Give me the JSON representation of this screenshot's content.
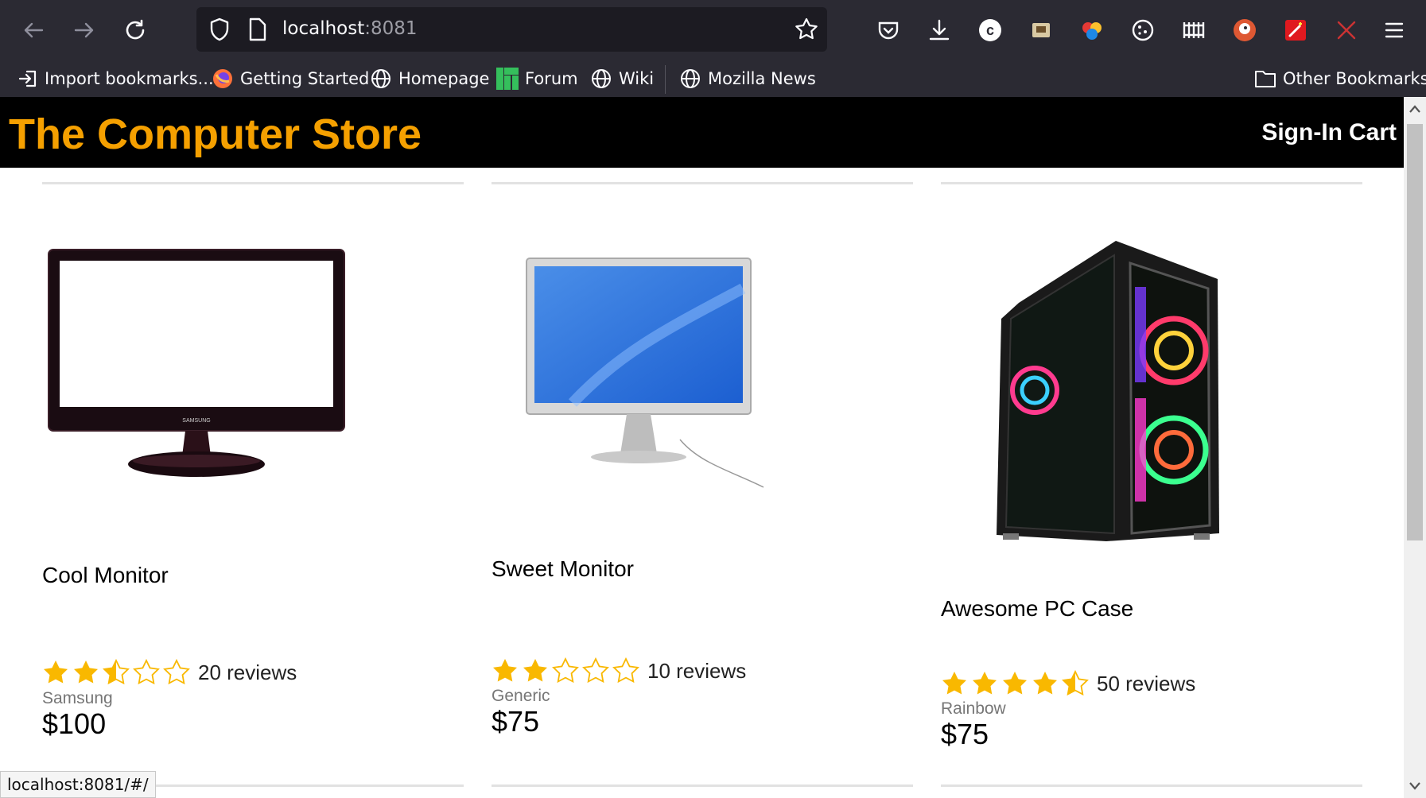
{
  "browser": {
    "url_host": "localhost",
    "url_port": ":8081",
    "bookmarks": [
      {
        "label": "Import bookmarks...",
        "icon": "import-icon"
      },
      {
        "label": "Getting Started",
        "icon": "firefox-icon"
      },
      {
        "label": "Homepage",
        "icon": "globe-icon"
      },
      {
        "label": "Forum",
        "icon": "manjaro-icon"
      },
      {
        "label": "Wiki",
        "icon": "globe-icon"
      },
      {
        "label": "Mozilla News",
        "icon": "globe-icon"
      }
    ],
    "other_bookmarks": "Other Bookmarks",
    "status_url": "localhost:8081/#/"
  },
  "site": {
    "title": "The Computer Store",
    "signin": "Sign-In",
    "cart": "Cart",
    "accent": "#f5a000"
  },
  "products": [
    {
      "name": "Cool Monitor",
      "rating": 2.5,
      "reviews": "20 reviews",
      "brand": "Samsung",
      "price": "$100"
    },
    {
      "name": "Sweet Monitor",
      "rating": 2,
      "reviews": "10 reviews",
      "brand": "Generic",
      "price": "$75"
    },
    {
      "name": "Awesome PC Case",
      "rating": 4.5,
      "reviews": "50 reviews",
      "brand": "Rainbow",
      "price": "$75"
    }
  ]
}
